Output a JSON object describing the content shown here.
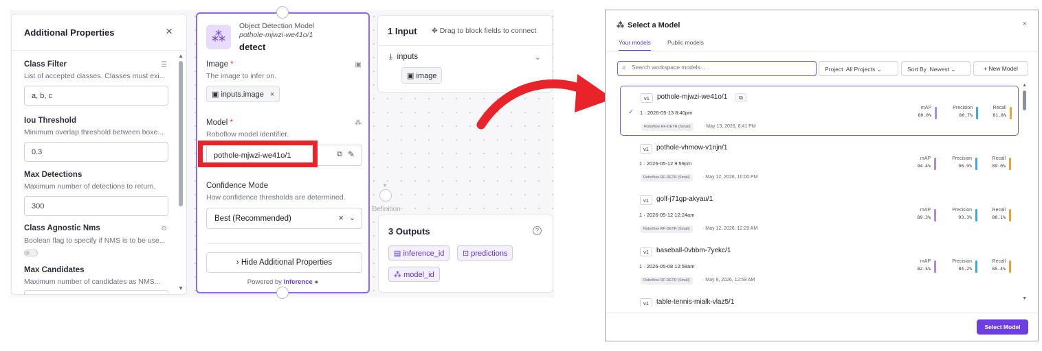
{
  "colors": {
    "accent": "#6d3fe0",
    "highlight_red": "#e8232a",
    "map_bar": "#a58af0",
    "precision_bar": "#3fa7e6",
    "recall_bar": "#f2a22d"
  },
  "props_panel": {
    "title": "Additional Properties",
    "close": "×",
    "fields": [
      {
        "label": "Class Filter",
        "desc": "List of accepted classes. Classes must exi...",
        "value": "a, b, c",
        "icon": "list-icon"
      },
      {
        "label": "Iou Threshold",
        "desc": "Minimum overlap threshold between boxe...",
        "value": "0.3"
      },
      {
        "label": "Max Detections",
        "desc": "Maximum number of detections to return.",
        "value": "300"
      },
      {
        "label": "Class Agnostic Nms",
        "desc": "Boolean flag to specify if NMS is to be use...",
        "icon": "link-icon"
      },
      {
        "label": "Max Candidates",
        "desc": "Maximum number of candidates as NMS..."
      }
    ]
  },
  "block": {
    "type": "Object Detection Model",
    "model_id": "pothole-mjwzi-we41o/1",
    "name": "detect",
    "image_label": "Image",
    "image_desc": "The image to infer on.",
    "image_chip": "inputs.image",
    "model_label": "Model",
    "model_desc": "Roboflow model identifier.",
    "model_value": "pothole-mjwzi-we41o/1",
    "confidence_label": "Confidence Mode",
    "confidence_desc": "How confidence thresholds are determined.",
    "confidence_value": "Best (Recommended)",
    "hide_button": "Hide Additional Properties",
    "powered_prefix": "Powered by",
    "powered_brand": "Inference"
  },
  "inputs_panel": {
    "title": "1 Input",
    "hint": "Drag to block fields to connect",
    "row": "inputs",
    "chip": "image"
  },
  "outputs_panel": {
    "title": "3 Outputs",
    "chips": [
      "inference_id",
      "predictions",
      "model_id"
    ]
  },
  "canvas_faint": {
    "definition": "Definition"
  },
  "modal": {
    "title": "Select a Model",
    "close": "×",
    "tabs": [
      "Your models",
      "Public models"
    ],
    "search_placeholder": "Search workspace models...",
    "project_label": "Project",
    "project_value": "All Projects",
    "sort_label": "Sort By",
    "sort_value": "Newest",
    "new_model": "+ New Model",
    "select_button": "Select Model",
    "metric_labels": [
      "mAP",
      "Precision",
      "Recall"
    ],
    "models": [
      {
        "version": "v1",
        "name": "pothole-mjwzi-we41o/1",
        "date": "1 · 2026-05-13 8:40pm",
        "arch": "Roboflow RF-DETR (Small)",
        "trained": "· May 13, 2026, 8:41 PM",
        "map": "80.0%",
        "precision": "80.7%",
        "recall": "81.8%",
        "selected": true
      },
      {
        "version": "v1",
        "name": "pothole-vhmow-v1njn/1",
        "date": "1 · 2026-05-12 9:59pm",
        "arch": "Roboflow RF-DETR (Small)",
        "trained": "· May 12, 2026, 10:00 PM",
        "map": "94.4%",
        "precision": "96.9%",
        "recall": "89.0%"
      },
      {
        "version": "v1",
        "name": "golf-j71gp-akyau/1",
        "date": "1 · 2026-05-12 12:24am",
        "arch": "Roboflow RF-DETR (Small)",
        "trained": "· May 12, 2026, 12:29 AM",
        "map": "89.3%",
        "precision": "93.3%",
        "recall": "88.1%"
      },
      {
        "version": "v1",
        "name": "baseball-0vbbm-7yekc/1",
        "date": "1 · 2026-05-08 12:58am",
        "arch": "Roboflow RF-DETR (Small)",
        "trained": "· May 8, 2026, 12:59 AM",
        "map": "82.5%",
        "precision": "84.2%",
        "recall": "85.4%"
      },
      {
        "version": "v1",
        "name": "table-tennis-mialk-vlaz5/1"
      }
    ]
  }
}
